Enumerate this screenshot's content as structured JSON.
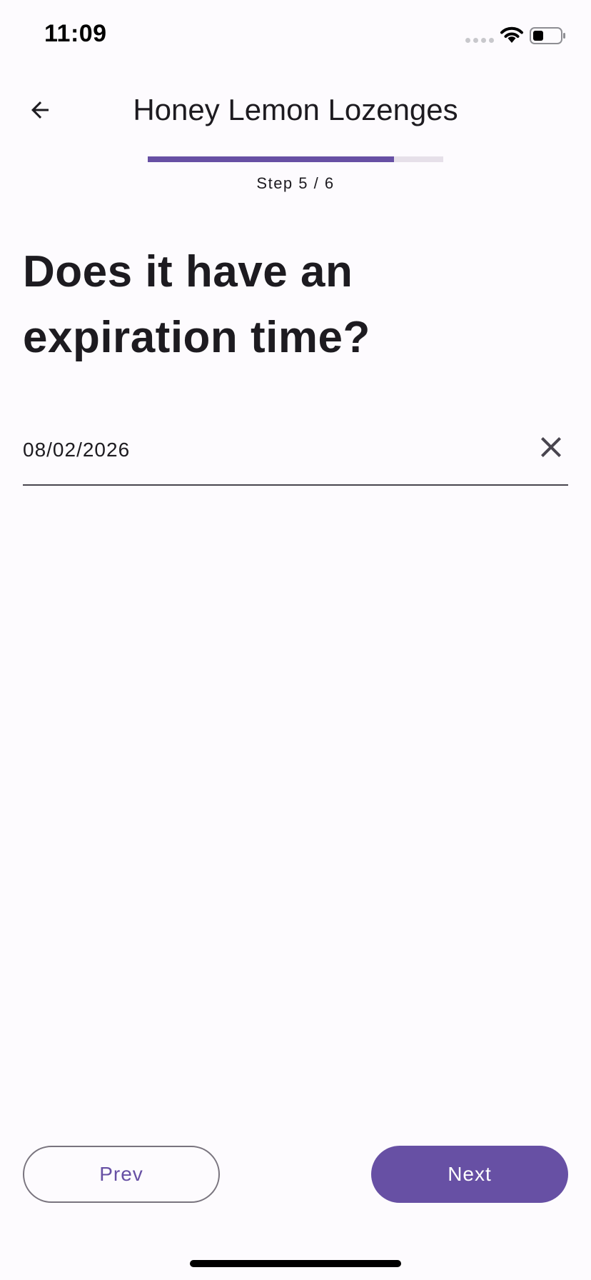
{
  "status_bar": {
    "time": "11:09",
    "signal_icon": "cellular-signal-icon",
    "wifi_icon": "wifi-icon",
    "battery_icon": "battery-icon"
  },
  "app_bar": {
    "back_icon": "arrow-back-icon",
    "title": "Honey Lemon Lozenges"
  },
  "progress": {
    "current_step": 5,
    "total_steps": 6,
    "fraction": 0.833,
    "label": "Step 5 / 6"
  },
  "question": {
    "text": "Does it have an expiration time?"
  },
  "date_field": {
    "value": "08/02/2026",
    "clear_icon": "close-icon"
  },
  "navigation": {
    "prev_label": "Prev",
    "next_label": "Next"
  },
  "colors": {
    "accent": "#6750A4",
    "background": "#FDFBFE",
    "track": "#E6E0E9",
    "outline": "#79747E"
  }
}
